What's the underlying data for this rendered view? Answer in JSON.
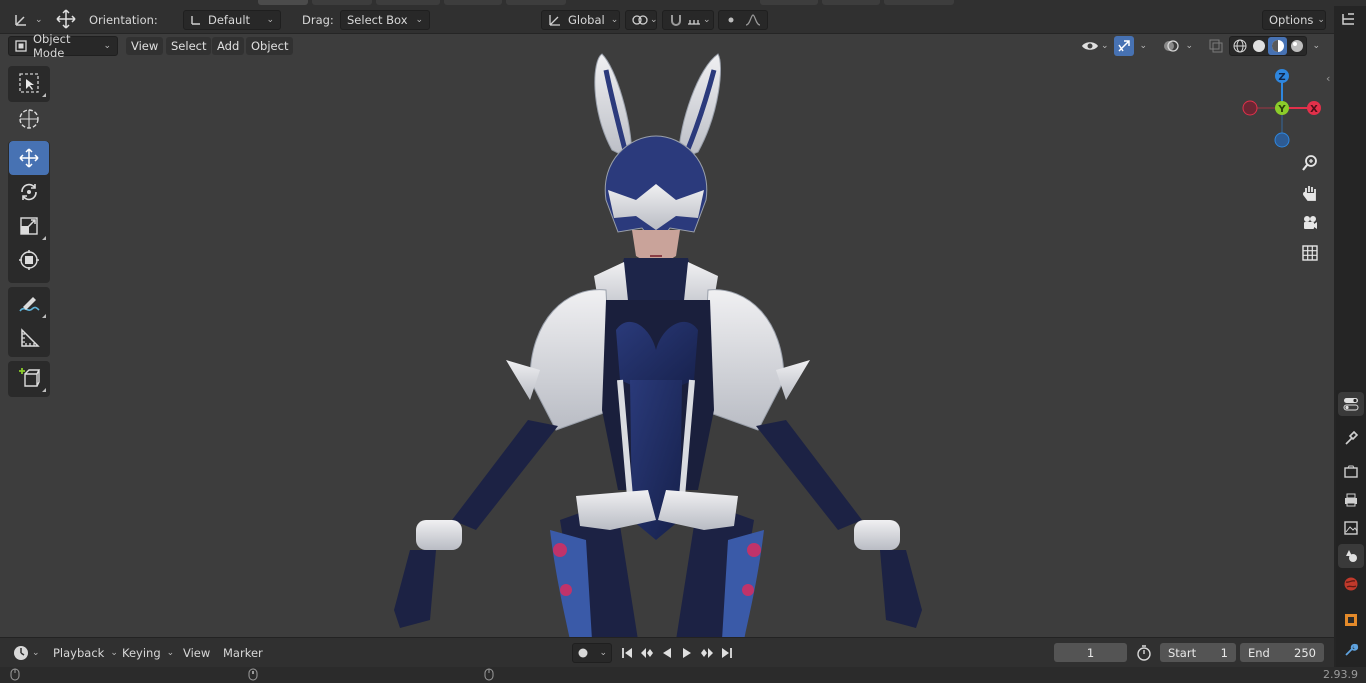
{
  "header": {
    "orientation_label": "Orientation:",
    "orientation_value": "Default",
    "drag_label": "Drag:",
    "drag_value": "Select Box",
    "transform_orientation": "Global",
    "options_label": "Options"
  },
  "viewport_header": {
    "mode": "Object Mode",
    "menus": [
      "View",
      "Select",
      "Add",
      "Object"
    ]
  },
  "gizmo": {
    "z": "Z",
    "y": "Y",
    "x": "X"
  },
  "timeline": {
    "menus": [
      "Playback",
      "Keying",
      "View",
      "Marker"
    ],
    "current_frame": "1",
    "start_label": "Start",
    "start_value": "1",
    "end_label": "End",
    "end_value": "250"
  },
  "status": {
    "version": "2.93.9"
  },
  "colors": {
    "accent": "#4772b3",
    "axis_x": "#e2304a",
    "axis_y": "#8bcc2a",
    "axis_z": "#2e86de",
    "viewport_bg": "#3d3d3d"
  }
}
